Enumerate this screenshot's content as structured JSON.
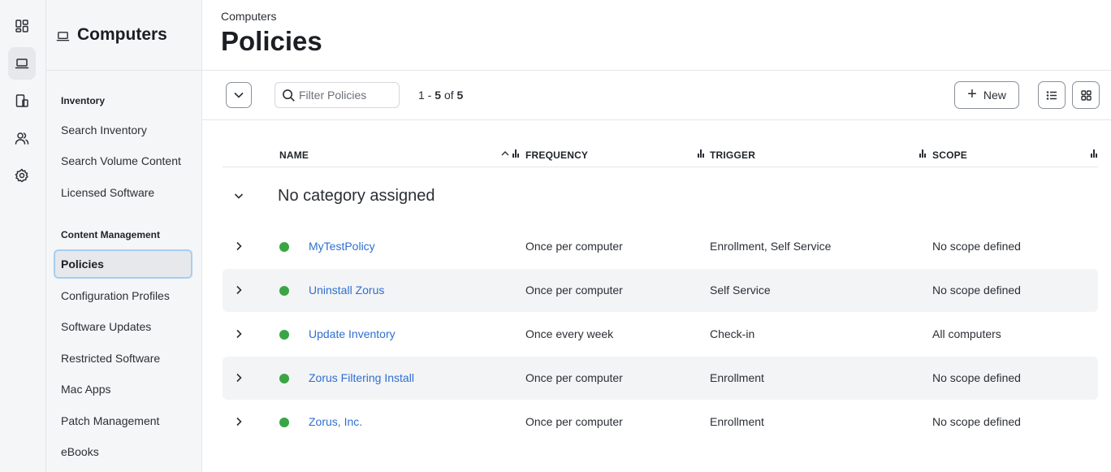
{
  "rail": {
    "items": [
      {
        "icon": "dashboard-icon",
        "active": false
      },
      {
        "icon": "laptop-icon",
        "active": true
      },
      {
        "icon": "devices-icon",
        "active": false
      },
      {
        "icon": "users-icon",
        "active": false
      },
      {
        "icon": "gear-icon",
        "active": false
      }
    ]
  },
  "sidebar": {
    "title": "Computers",
    "sections": [
      {
        "label": "Inventory",
        "items": [
          "Search Inventory",
          "Search Volume Content",
          "Licensed Software"
        ]
      },
      {
        "label": "Content Management",
        "items": [
          "Policies",
          "Configuration Profiles",
          "Software Updates",
          "Restricted Software",
          "Mac Apps",
          "Patch Management",
          "eBooks"
        ]
      }
    ],
    "active_item": "Policies"
  },
  "header": {
    "breadcrumb": "Computers",
    "title": "Policies"
  },
  "toolbar": {
    "filter_placeholder": "Filter Policies",
    "filter_value": "",
    "count_start": "1",
    "count_end": "5",
    "count_of": "of",
    "count_total": "5",
    "new_label": "New"
  },
  "table": {
    "columns": [
      "NAME",
      "FREQUENCY",
      "TRIGGER",
      "SCOPE"
    ],
    "group_label": "No category assigned",
    "status_color": "#3aa545",
    "link_color": "#2f6fd0",
    "rows": [
      {
        "name": "MyTestPolicy",
        "frequency": "Once per computer",
        "trigger": "Enrollment, Self Service",
        "scope": "No scope defined"
      },
      {
        "name": "Uninstall Zorus",
        "frequency": "Once per computer",
        "trigger": "Self Service",
        "scope": "No scope defined"
      },
      {
        "name": "Update Inventory",
        "frequency": "Once every week",
        "trigger": "Check-in",
        "scope": "All computers"
      },
      {
        "name": "Zorus Filtering Install",
        "frequency": "Once per computer",
        "trigger": "Enrollment",
        "scope": "No scope defined"
      },
      {
        "name": "Zorus, Inc.",
        "frequency": "Once per computer",
        "trigger": "Enrollment",
        "scope": "No scope defined"
      }
    ]
  }
}
